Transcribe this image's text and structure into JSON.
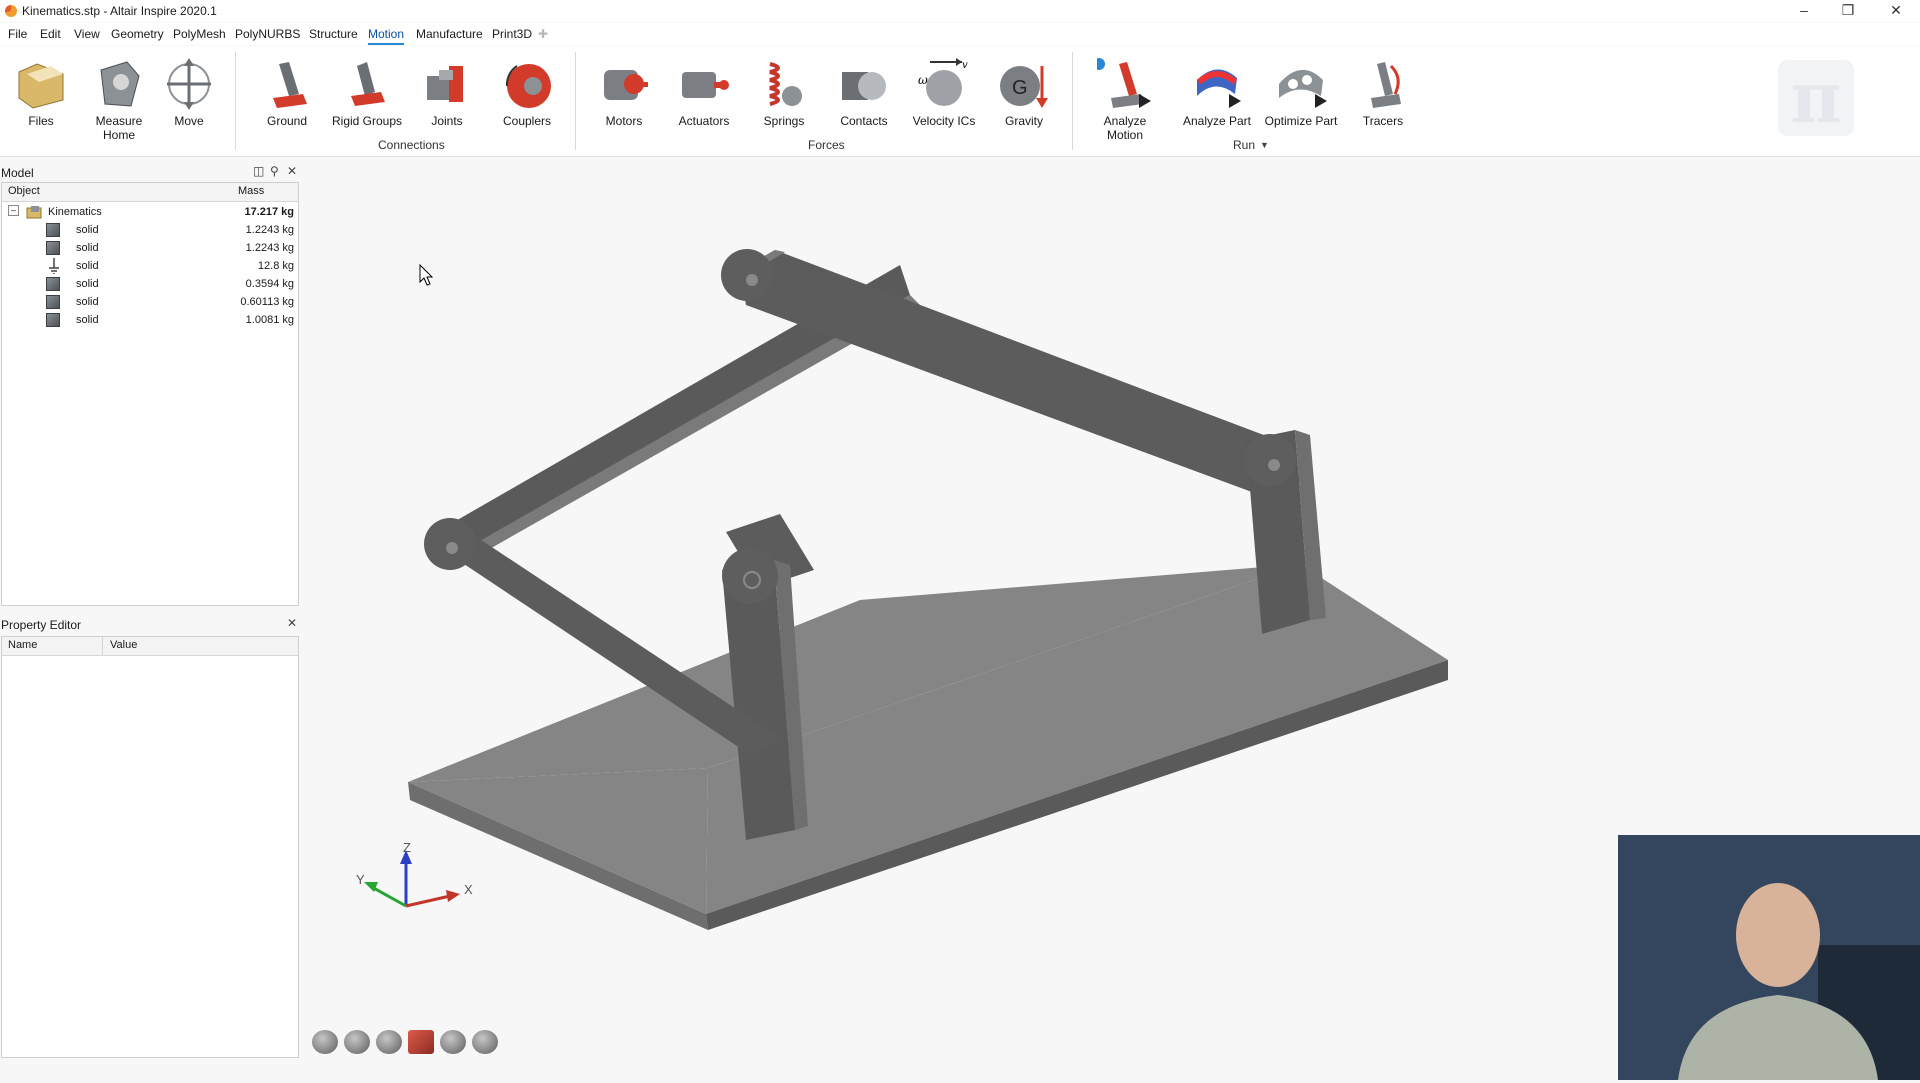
{
  "window": {
    "title": "Kinematics.stp - Altair Inspire 2020.1",
    "controls": [
      "minimize-icon",
      "restore-icon",
      "close-icon"
    ]
  },
  "menu": [
    "File",
    "Edit",
    "View",
    "Geometry",
    "PolyMesh",
    "PolyNURBS",
    "Structure",
    "Motion",
    "Manufacture",
    "Print3D"
  ],
  "menu_active": "Motion",
  "ribbon": {
    "files": "Files",
    "measure_l1": "Measure",
    "measure_l2": "Home",
    "move": "Move",
    "ground": "Ground",
    "rigid_groups": "Rigid Groups",
    "joints": "Joints",
    "couplers": "Couplers",
    "connections_group": "Connections",
    "motors": "Motors",
    "actuators": "Actuators",
    "springs": "Springs",
    "contacts": "Contacts",
    "velocity_ics": "Velocity ICs",
    "gravity": "Gravity",
    "forces_group": "Forces",
    "analyze_motion": "Analyze Motion",
    "analyze_part": "Analyze Part",
    "optimize_part": "Optimize Part",
    "run_group": "Run",
    "tracers": "Tracers"
  },
  "model_panel": {
    "title": "Model",
    "col_object": "Object",
    "col_mass": "Mass",
    "root": {
      "name": "Kinematics",
      "mass": "17.217 kg"
    },
    "rows": [
      {
        "name": "solid",
        "mass": "1.2243 kg",
        "icon": "solid-icon"
      },
      {
        "name": "solid",
        "mass": "1.2243 kg",
        "icon": "solid-icon"
      },
      {
        "name": "solid",
        "mass": "12.8 kg",
        "icon": "ground-icon"
      },
      {
        "name": "solid",
        "mass": "0.3594 kg",
        "icon": "solid-icon"
      },
      {
        "name": "solid",
        "mass": "0.60113 kg",
        "icon": "solid-icon"
      },
      {
        "name": "solid",
        "mass": "1.0081 kg",
        "icon": "solid-icon"
      }
    ]
  },
  "property_editor": {
    "title": "Property Editor",
    "col_name": "Name",
    "col_value": "Value"
  },
  "triad": {
    "z": "Z",
    "y": "Y",
    "x": "X"
  },
  "colors": {
    "accent": "#2a86d6",
    "part": "#6b6b6b",
    "base_top": "#888888"
  }
}
